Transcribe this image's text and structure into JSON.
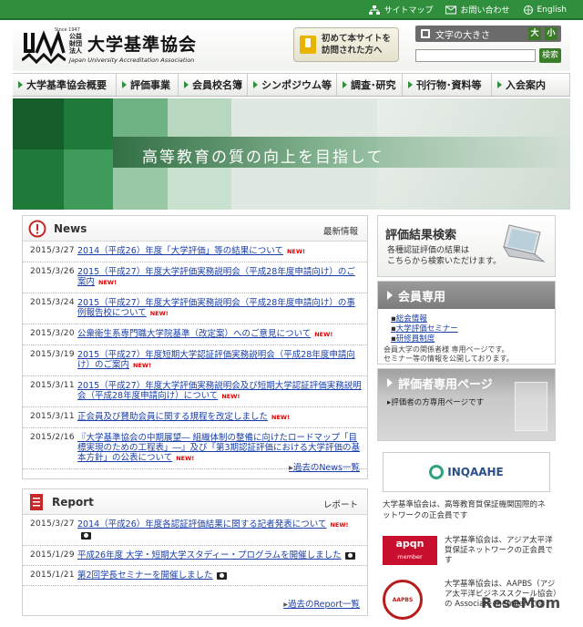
{
  "toplinks": [
    {
      "label": "サイトマップ",
      "icon": "sitemap-icon"
    },
    {
      "label": "お問い合わせ",
      "icon": "mail-icon"
    },
    {
      "label": "English",
      "icon": "globe-icon"
    }
  ],
  "header": {
    "logo_since": "Since 1947",
    "logo_small": "公益財団法人",
    "logo_title": "大学基準協会",
    "logo_en": "Japan University Accreditation Association",
    "first_visit_line1": "初めて本サイトを",
    "first_visit_line2": "訪問された方へ",
    "fontsize_label": "文字の大きさ",
    "fontsize_large": "大",
    "fontsize_small": "小",
    "search_value": "",
    "search_button": "検索"
  },
  "nav": [
    {
      "label": "大学基準協会概要",
      "width": 114
    },
    {
      "label": "評価事業",
      "width": 68
    },
    {
      "label": "会員校名簿",
      "width": 76
    },
    {
      "label": "シンポジウム等",
      "width": 98
    },
    {
      "label": "調査･研究",
      "width": 72
    },
    {
      "label": "刊行物･資料等",
      "width": 98
    },
    {
      "label": "入会案内",
      "width": 86
    }
  ],
  "hero": {
    "tagline": "高等教育の質の向上を目指して"
  },
  "news": {
    "title": "News",
    "sub": "最新情報",
    "more": "過去のNews一覧",
    "items": [
      {
        "date": "2015/3/27",
        "text": "2014（平成26）年度「大学評価」等の結果について",
        "new": "NEW!"
      },
      {
        "date": "2015/3/26",
        "text": "2015（平成27）年度大学評価実務説明会（平成28年度申請向け）のご案内",
        "new": "NEW!"
      },
      {
        "date": "2015/3/24",
        "text": "2015（平成27）年度大学評価実務説明会（平成28年度申請向け）の事例報告校について",
        "new": "NEW!"
      },
      {
        "date": "2015/3/20",
        "text": "公衆衛生系専門職大学院基準（改定案）へのご意見について",
        "new": "NEW!"
      },
      {
        "date": "2015/3/19",
        "text": "2015（平成27）年度短期大学認証評価実務説明会（平成28年度申請向け）のご案内",
        "new": "NEW!"
      },
      {
        "date": "2015/3/11",
        "text": "2015（平成27）年度大学評価実務説明会及び短期大学認証評価実務説明会（平成28年度申請向け）について",
        "new": "NEW!"
      },
      {
        "date": "2015/3/11",
        "text": "正会員及び賛助会員に関する規程を改定しました",
        "new": "NEW!"
      },
      {
        "date": "2015/2/16",
        "text": "『大学基準協会の中期展望― 組織体制の整備に向けたロードマップ「目標実現のための工程表」―』及び「第3期認証評価における大学評価の基本方針」の公表について",
        "new": "NEW!"
      }
    ]
  },
  "report": {
    "title": "Report",
    "sub": "レポート",
    "more": "過去のReport一覧",
    "items": [
      {
        "date": "2015/3/27",
        "text": "2014（平成26）年度各認証評価結果に関する記者発表について",
        "new": "NEW!"
      },
      {
        "date": "2015/1/29",
        "text": "平成26年度 大学・短期大学スタディー・プログラムを開催しました",
        "new": ""
      },
      {
        "date": "2015/1/21",
        "text": "第2回学長セミナーを開催しました",
        "new": ""
      }
    ]
  },
  "right": {
    "eval_title": "評価結果検索",
    "eval_line1": "各種認証評価の結果は",
    "eval_line2": "こちらから検索いただけます。",
    "member_title": "会員専用",
    "member_links": [
      "総会情報",
      "大学評価セミナー",
      "研修員制度"
    ],
    "member_note1": "会員大学の関係者様 専用ページです。",
    "member_note2": "セミナー等の情報を公開しております。",
    "eval_only_title": "評価者専用ページ",
    "eval_only_sub": "評価者の方専用ページです",
    "inqaahe": "INQAAHE",
    "inqaahe_text": "大学基準協会は、高等教育質保証機関国際的ネットワークの正会員です",
    "apqn": "apqn",
    "apqn_small": "member",
    "apqn_text": "大学基準協会は、アジア太平洋質保証ネットワークの正会員です",
    "aapbs": "AAPBS",
    "aapbs_text": "大学基準協会は、AAPBS（アジア太平洋ビジネススクール協会）の Associate member です"
  },
  "watermark": "ReseMom",
  "colors": {
    "brand_green": "#2f8f3d",
    "link_blue": "#1a3fa8",
    "new_red": "#e60000"
  }
}
